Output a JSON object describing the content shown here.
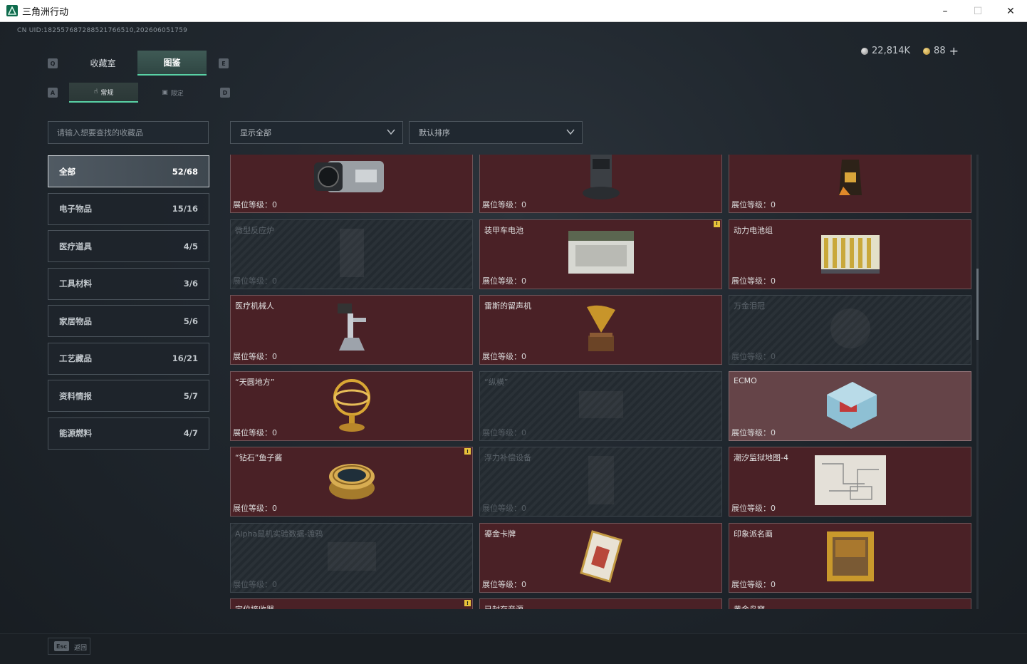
{
  "window": {
    "title": "三角洲行动",
    "minimize": "–",
    "maximize": "☐",
    "close": "✕"
  },
  "header": {
    "uid": "CN UID:1825576872885217665​10,202606051759",
    "currency": {
      "silver": "22,814K",
      "gold": "88",
      "add": "+"
    }
  },
  "keys": {
    "q": "Q",
    "e": "E",
    "a": "A",
    "d": "D"
  },
  "tabs": [
    {
      "label": "收藏室",
      "active": false
    },
    {
      "label": "图鉴",
      "active": true
    }
  ],
  "subtabs": [
    {
      "label": "常规",
      "active": true
    },
    {
      "label": "限定",
      "active": false
    }
  ],
  "search": {
    "placeholder": "请输入想要查找的收藏品"
  },
  "filters": {
    "display": "显示全部",
    "sort": "默认排序"
  },
  "categories": [
    {
      "label": "全部",
      "count": "52/68",
      "active": true
    },
    {
      "label": "电子物品",
      "count": "15/16"
    },
    {
      "label": "医疗道具",
      "count": "4/5"
    },
    {
      "label": "工具材料",
      "count": "3/6"
    },
    {
      "label": "家居物品",
      "count": "5/6"
    },
    {
      "label": "工艺藏品",
      "count": "16/21"
    },
    {
      "label": "资料情报",
      "count": "5/7"
    },
    {
      "label": "能源燃料",
      "count": "4/7"
    }
  ],
  "level_prefix": "展位等级：",
  "items": [
    {
      "name": "",
      "level": "展位等级：0",
      "state": "owned",
      "icon": "camera-icon"
    },
    {
      "name": "",
      "level": "展位等级：0",
      "state": "owned",
      "icon": "robot-vacuum-icon"
    },
    {
      "name": "",
      "level": "展位等级：0",
      "state": "owned",
      "icon": "coffee-bag-icon"
    },
    {
      "name": "微型反应炉",
      "level": "展位等级：0",
      "state": "locked",
      "icon": "reactor-icon"
    },
    {
      "name": "装甲车电池",
      "level": "展位等级：0",
      "state": "owned",
      "icon": "battery-icon",
      "marker": "!"
    },
    {
      "name": "动力电池组",
      "level": "展位等级：0",
      "state": "owned",
      "icon": "battery-pack-icon"
    },
    {
      "name": "医疗机械人",
      "level": "展位等级：0",
      "state": "owned",
      "icon": "medical-robot-icon"
    },
    {
      "name": "雷斯的留声机",
      "level": "展位等级：0",
      "state": "owned",
      "icon": "gramophone-icon"
    },
    {
      "name": "万金泪冠",
      "level": "展位等级：0",
      "state": "locked",
      "icon": "crown-icon"
    },
    {
      "name": "“天圆地方”",
      "level": "展位等级：0",
      "state": "owned",
      "icon": "armillary-icon"
    },
    {
      "name": "“纵横”",
      "level": "展位等级：0",
      "state": "locked",
      "icon": "chessboard-icon"
    },
    {
      "name": "ECMO",
      "level": "展位等级：0",
      "state": "highlight",
      "icon": "ecmo-icon"
    },
    {
      "name": "“钻石”鱼子酱",
      "level": "展位等级：0",
      "state": "owned",
      "icon": "caviar-icon",
      "marker": "!"
    },
    {
      "name": "浮力补偿设备",
      "level": "展位等级：0",
      "state": "locked",
      "icon": "bcd-icon"
    },
    {
      "name": "潮汐监狱地图-4",
      "level": "展位等级：0",
      "state": "owned",
      "icon": "map-icon"
    },
    {
      "name": "Alpha鼠机实验数据-渡鸦",
      "level": "展位等级：0",
      "state": "locked",
      "icon": "drive-icon"
    },
    {
      "name": "鎏金卡牌",
      "level": "展位等级：0",
      "state": "owned",
      "icon": "card-icon"
    },
    {
      "name": "印象派名画",
      "level": "展位等级：0",
      "state": "owned",
      "icon": "painting-icon"
    },
    {
      "name": "定位接收器",
      "level": "",
      "state": "owned",
      "icon": "receiver-icon",
      "marker": "!"
    },
    {
      "name": "已封存音源",
      "level": "",
      "state": "owned",
      "icon": "sealed-audio-icon"
    },
    {
      "name": "黄金鸟窝",
      "level": "",
      "state": "owned",
      "icon": "golden-nest-icon"
    }
  ],
  "footer": {
    "esc": "Esc",
    "back": "返回"
  }
}
